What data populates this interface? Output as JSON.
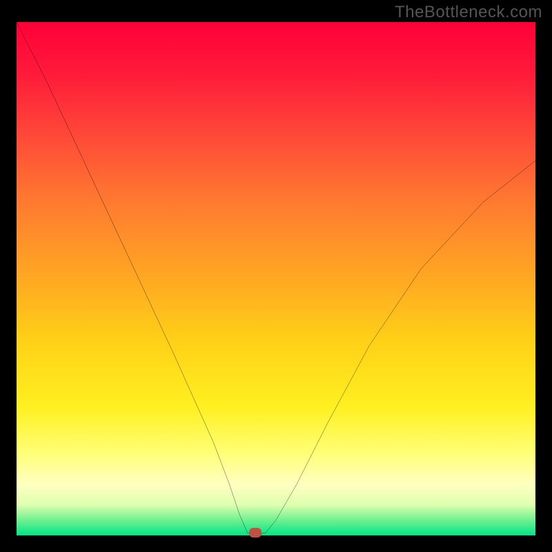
{
  "watermark": "TheBottleneck.com",
  "chart_data": {
    "type": "line",
    "title": "",
    "xlabel": "",
    "ylabel": "",
    "xlim": [
      0,
      100
    ],
    "ylim": [
      0,
      100
    ],
    "series": [
      {
        "name": "curve",
        "x": [
          0,
          6,
          12,
          18,
          24,
          30,
          34,
          38,
          41,
          43,
          44.5,
          46,
          48,
          50,
          54,
          60,
          68,
          78,
          90,
          100
        ],
        "values": [
          100,
          88,
          75,
          62,
          49,
          36,
          27,
          18,
          10,
          4,
          0.5,
          0.2,
          0.5,
          3,
          10,
          22,
          37,
          52,
          65,
          73
        ]
      }
    ],
    "marker": {
      "x": 46,
      "y": 0.5
    },
    "grid": false,
    "legend": false
  }
}
